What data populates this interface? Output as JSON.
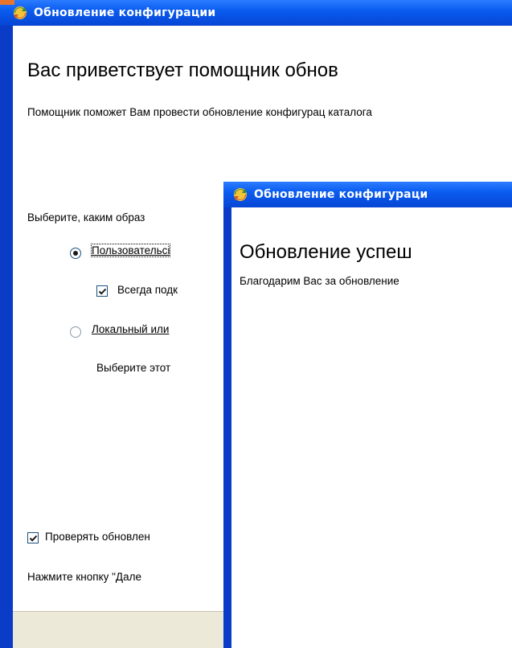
{
  "back_window": {
    "title": "Обновление конфигурации",
    "heading": "Вас приветствует помощник обнов",
    "description": "Помощник поможет Вам провести обновление конфигурац каталога",
    "choose_prompt": "Выберите, каким образ",
    "option_user": {
      "label": "Пользовательсі",
      "selected": true
    },
    "always_connect": {
      "label": "Всегда подк",
      "checked": true
    },
    "option_local": {
      "label": "Локальный или",
      "selected": false
    },
    "local_hint": "Выберите этот",
    "check_updates": {
      "label": "Проверять обновлен",
      "checked": true
    },
    "press_next": "Нажмите кнопку \"Дале"
  },
  "front_window": {
    "title": "Обновление конфигураци",
    "heading": "Обновление успеш",
    "thanks": "Благодарим Вас за обновление"
  },
  "icons": {
    "app_icon": "1c-update-icon",
    "check_icon": "checkmark-icon"
  },
  "colors": {
    "titlebar_blue": "#0a5cf0",
    "frame_blue": "#0a3cc8",
    "dialog_bg": "#ffffff",
    "bar_bg": "#ece9d8"
  }
}
